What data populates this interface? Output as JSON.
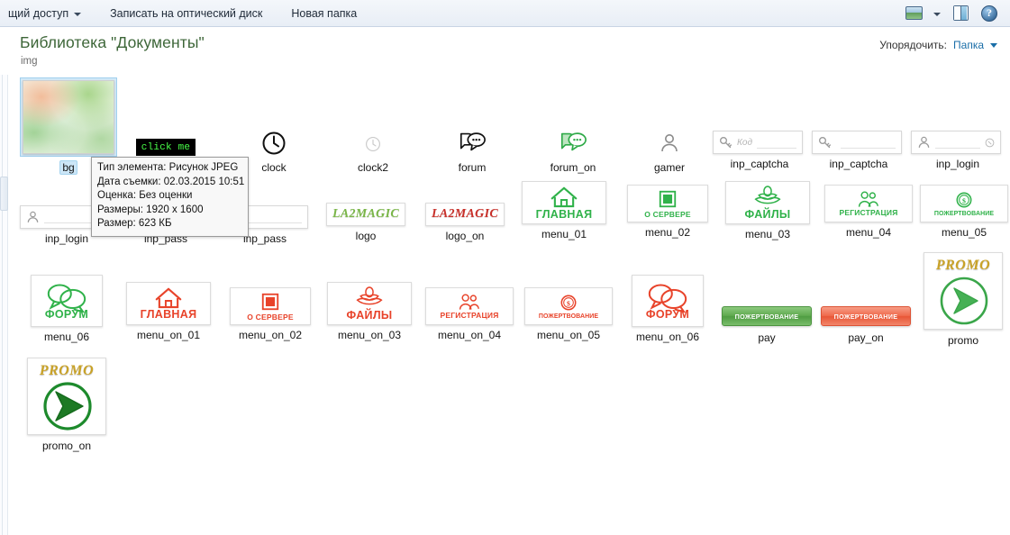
{
  "toolbar": {
    "items": [
      {
        "label": "щий доступ",
        "caret": true
      },
      {
        "label": "Записать на оптический диск",
        "caret": false
      },
      {
        "label": "Новая папка",
        "caret": false
      }
    ],
    "view_icon": "view-layout-icon",
    "view_caret": "chevron-down-icon",
    "preview_pane_icon": "preview-pane-icon",
    "help_icon": "help-icon",
    "help_glyph": "?"
  },
  "header": {
    "title": "Библиотека \"Документы\"",
    "subtitle": "img",
    "arrange_label": "Упорядочить:",
    "arrange_value": "Папка",
    "arrange_caret": "chevron-down-icon",
    "title_color": "#3d6638",
    "link_color": "#1a6ea8"
  },
  "overlay": {
    "badge_text": "click me",
    "badge_bg": "#000000",
    "badge_fg": "#49ff49",
    "tooltip_lines": [
      "Тип элемента: Рисунок JPEG",
      "Дата съемки: 02.03.2015 10:51",
      "Оценка: Без оценки",
      "Размеры: 1920 x 1600",
      "Размер: 623 КБ"
    ]
  },
  "colors": {
    "green": "#30b24a",
    "red": "#e8432a",
    "logo_green": "#7ab648",
    "logo_red": "#c8302a",
    "promo_gold": "#c9a227"
  },
  "items": {
    "bg": {
      "label": "bg",
      "icon": "picture-thumbnail"
    },
    "clock": {
      "label": "clock",
      "icon": "clock-icon"
    },
    "clock2": {
      "label": "clock2",
      "icon": "clock-faded-icon"
    },
    "forum": {
      "label": "forum",
      "icon": "speech-bubbles-icon"
    },
    "forum_on": {
      "label": "forum_on",
      "icon": "speech-bubbles-green-icon"
    },
    "gamer": {
      "label": "gamer",
      "icon": "person-icon"
    },
    "inp_captcha1": {
      "label": "inp_captcha",
      "icon": "key-icon",
      "placeholder": "Код"
    },
    "inp_captcha2": {
      "label": "inp_captcha",
      "icon": "key-icon",
      "placeholder": ""
    },
    "inp_login1": {
      "label": "inp_login",
      "icon": "person-icon",
      "placeholder": ""
    },
    "inp_login2": {
      "label": "inp_login",
      "icon": "person-icon",
      "placeholder": ""
    },
    "inp_pass1": {
      "label": "inp_pass",
      "icon": "key-icon",
      "placeholder": ""
    },
    "inp_pass2": {
      "label": "inp_pass",
      "icon": "key-icon",
      "placeholder": ""
    },
    "logo": {
      "label": "logo",
      "text": "LA2MAGIC"
    },
    "logo_on": {
      "label": "logo_on",
      "text": "LA2MAGIC"
    },
    "menu_01": {
      "label": "menu_01",
      "caption": "ГЛАВНАЯ",
      "icon": "home-icon",
      "state": "green"
    },
    "menu_02": {
      "label": "menu_02",
      "caption": "О СЕРВЕРЕ",
      "icon": "note-icon",
      "state": "green"
    },
    "menu_03": {
      "label": "menu_03",
      "caption": "ФАЙЛЫ",
      "icon": "files-icon",
      "state": "green"
    },
    "menu_04": {
      "label": "menu_04",
      "caption": "РЕГИСТРАЦИЯ",
      "icon": "users-icon",
      "state": "green"
    },
    "menu_05": {
      "label": "menu_05",
      "caption": "ПОЖЕРТВОВАНИЕ",
      "icon": "coin-icon",
      "state": "green"
    },
    "menu_06": {
      "label": "menu_06",
      "caption": "ФОРУМ",
      "icon": "speech-bubbles-icon",
      "state": "green"
    },
    "menu_on_01": {
      "label": "menu_on_01",
      "caption": "ГЛАВНАЯ",
      "icon": "home-icon",
      "state": "red"
    },
    "menu_on_02": {
      "label": "menu_on_02",
      "caption": "О СЕРВЕРЕ",
      "icon": "note-icon",
      "state": "red"
    },
    "menu_on_03": {
      "label": "menu_on_03",
      "caption": "ФАЙЛЫ",
      "icon": "files-icon",
      "state": "red"
    },
    "menu_on_04": {
      "label": "menu_on_04",
      "caption": "РЕГИСТРАЦИЯ",
      "icon": "users-icon",
      "state": "red"
    },
    "menu_on_05": {
      "label": "menu_on_05",
      "caption": "ПОЖЕРТВОВАНИЕ",
      "icon": "coin-icon",
      "state": "red"
    },
    "menu_on_06": {
      "label": "menu_on_06",
      "caption": "ФОРУМ",
      "icon": "speech-bubbles-icon",
      "state": "red"
    },
    "pay": {
      "label": "pay",
      "caption": "ПОЖЕРТВОВАНИЕ",
      "state": "green"
    },
    "pay_on": {
      "label": "pay_on",
      "caption": "ПОЖЕРТВОВАНИЕ",
      "state": "red"
    },
    "promo": {
      "label": "promo",
      "caption": "PROMO",
      "icon": "play-arrow-outline-icon"
    },
    "promo_on": {
      "label": "promo_on",
      "caption": "PROMO",
      "icon": "play-arrow-filled-icon"
    }
  }
}
